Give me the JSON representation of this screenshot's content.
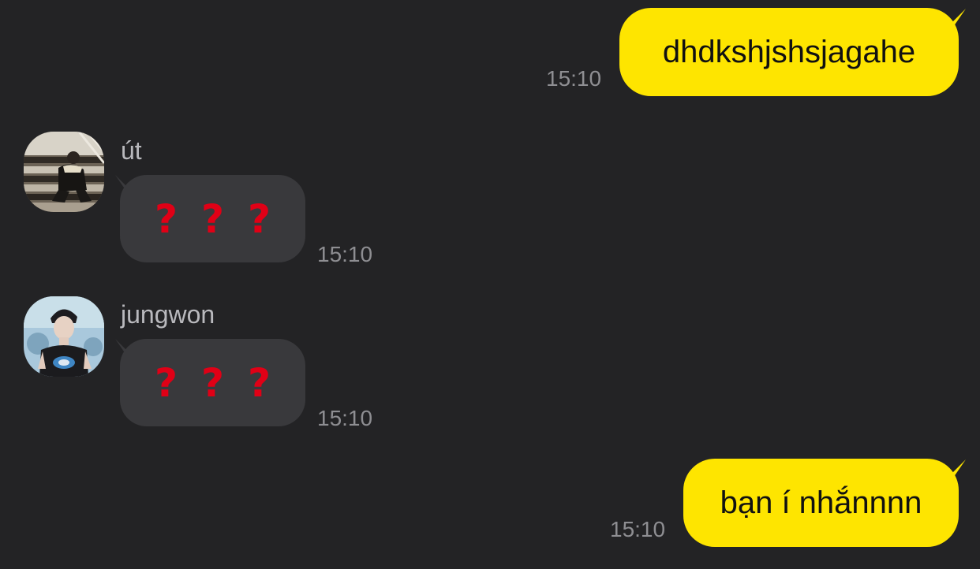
{
  "messages": [
    {
      "direction": "outgoing",
      "text": "dhdkshjshsjagahe",
      "time": "15:10"
    },
    {
      "direction": "incoming",
      "sender": "út",
      "avatar_icon": "user-avatar-stairs",
      "content": [
        "?",
        "?",
        "?"
      ],
      "time": "15:10"
    },
    {
      "direction": "incoming",
      "sender": "jungwon",
      "avatar_icon": "user-avatar-portrait",
      "content": [
        "?",
        "?",
        "?"
      ],
      "time": "15:10"
    },
    {
      "direction": "outgoing",
      "text": "bạn í nhắnnnn",
      "time": "15:10"
    }
  ],
  "colors": {
    "background": "#232325",
    "outgoing_bubble": "#fee500",
    "incoming_bubble": "#39393c",
    "question_mark": "#e00016",
    "timestamp": "#8e8e92",
    "sender_name": "#b9b9bd"
  }
}
